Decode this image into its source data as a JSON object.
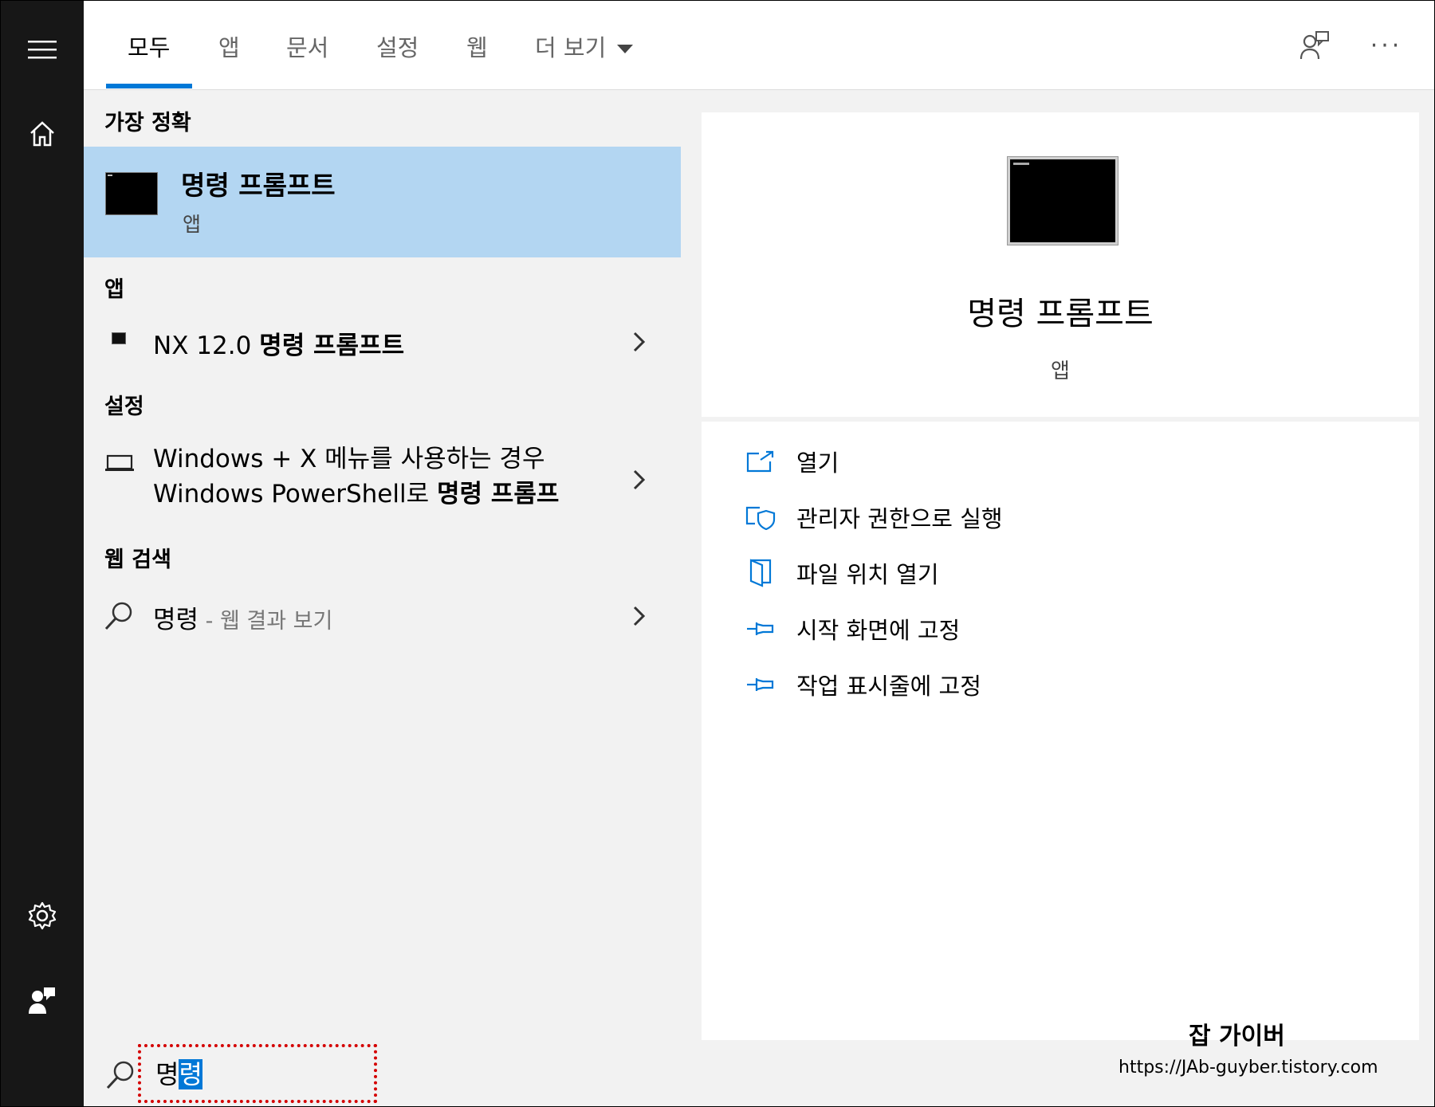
{
  "tabs": [
    {
      "label": "모두",
      "active": true
    },
    {
      "label": "앱"
    },
    {
      "label": "문서"
    },
    {
      "label": "설정"
    },
    {
      "label": "웹"
    },
    {
      "label": "더 보기"
    }
  ],
  "sections": {
    "best_match": "가장 정확",
    "apps": "앱",
    "settings": "설정",
    "web": "웹 검색"
  },
  "best_match": {
    "title": "명령 프롬프트",
    "subtitle": "앱"
  },
  "apps": [
    {
      "prefix": "NX 12.0 ",
      "bold": "명령 프롬프트"
    }
  ],
  "settings": [
    {
      "line1": "Windows + X 메뉴를 사용하는 경우",
      "line2_prefix": "Windows PowerShell로 ",
      "line2_bold": "명령 프롬프"
    }
  ],
  "web": {
    "query": "명령",
    "suffix": " - 웹 결과 보기"
  },
  "detail": {
    "title": "명령 프롬프트",
    "subtitle": "앱",
    "actions": [
      {
        "label": "열기",
        "icon": "open-icon"
      },
      {
        "label": "관리자 권한으로 실행",
        "icon": "admin-shield-icon"
      },
      {
        "label": "파일 위치 열기",
        "icon": "file-location-icon"
      },
      {
        "label": "시작 화면에 고정",
        "icon": "pin-icon"
      },
      {
        "label": "작업 표시줄에 고정",
        "icon": "pin-icon"
      }
    ]
  },
  "search": {
    "text_plain": "명",
    "text_selected": "령"
  },
  "watermark": {
    "title": "잡 가이버",
    "url": "https://JAb-guyber.tistory.com"
  },
  "colors": {
    "accent": "#0078d7",
    "selection": "#b3d6f2",
    "rail": "#171717",
    "highlight_box": "#d40000"
  }
}
